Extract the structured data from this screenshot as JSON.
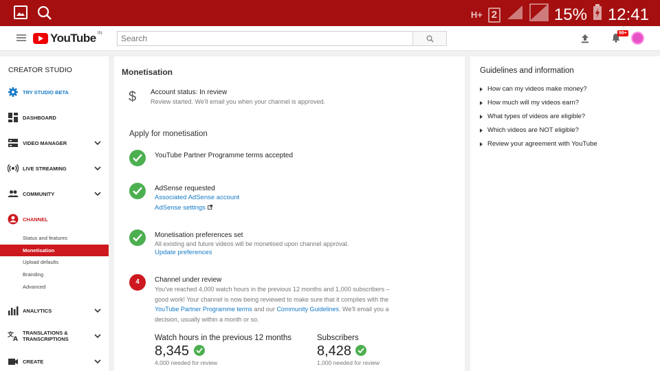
{
  "status_bar": {
    "network": "H+",
    "sim_slot": "2",
    "battery": "15%",
    "time": "12:41"
  },
  "topbar": {
    "logo_text": "YouTube",
    "country_code": "IN",
    "search_placeholder": "Search",
    "notification_count": "99+"
  },
  "sidebar": {
    "title": "CREATOR STUDIO",
    "items": [
      {
        "label": "TRY STUDIO BETA",
        "icon": "gear-icon"
      },
      {
        "label": "DASHBOARD",
        "icon": "dashboard-icon"
      },
      {
        "label": "VIDEO MANAGER",
        "icon": "video-manager-icon"
      },
      {
        "label": "LIVE STREAMING",
        "icon": "live-icon"
      },
      {
        "label": "COMMUNITY",
        "icon": "people-icon"
      },
      {
        "label": "CHANNEL",
        "icon": "account-icon"
      },
      {
        "label": "ANALYTICS",
        "icon": "bar-chart-icon"
      },
      {
        "label": "TRANSLATIONS & TRANSCRIPTIONS",
        "icon": "translate-icon"
      },
      {
        "label": "CREATE",
        "icon": "camera-icon"
      }
    ],
    "channel_sub": [
      "Status and features",
      "Monetisation",
      "Upload defaults",
      "Branding",
      "Advanced"
    ]
  },
  "main": {
    "title": "Monetisation",
    "account_status": "Account status: In review",
    "account_sub": "Review started. We'll email you when your channel is approved.",
    "apply_title": "Apply for monetisation",
    "step1_title": "YouTube Partner Programme terms accepted",
    "step2_title": "AdSense requested",
    "step2_link1": "Associated AdSense account",
    "step2_link2": "AdSense settings",
    "step3_title": "Monetisation preferences set",
    "step3_sub": "All existing and future videos will be monetised upon channel approval.",
    "step3_link": "Update preferences",
    "step4_number": "4",
    "step4_title": "Channel under review",
    "step4_text_a": "You've reached 4,000 watch hours in the previous 12 months and 1,000 subscribers – good work! Your channel is now being reviewed to make sure that it complies with the ",
    "step4_link_a": "YouTube Partner Programme terms",
    "step4_text_b": " and our ",
    "step4_link_b": "Community Guidelines",
    "step4_text_c": ". We'll email you a decision, usually within a month or so.",
    "watch_title": "Watch hours in the previous 12 months",
    "watch_value": "8,345",
    "watch_sub": "4,000 needed for review",
    "subs_title": "Subscribers",
    "subs_value": "8,428",
    "subs_sub": "1,000 needed for review"
  },
  "guidelines": {
    "title": "Guidelines and information",
    "items": [
      "How can my videos make money?",
      "How much will my videos earn?",
      "What types of videos are eligible?",
      "Which videos are NOT eligible?",
      "Review your agreement with YouTube"
    ]
  },
  "colors": {
    "status_bar": "#a50f0f",
    "accent_blue": "#167ac6",
    "youtube_red": "#cc181e",
    "success_green": "#4caf50"
  }
}
